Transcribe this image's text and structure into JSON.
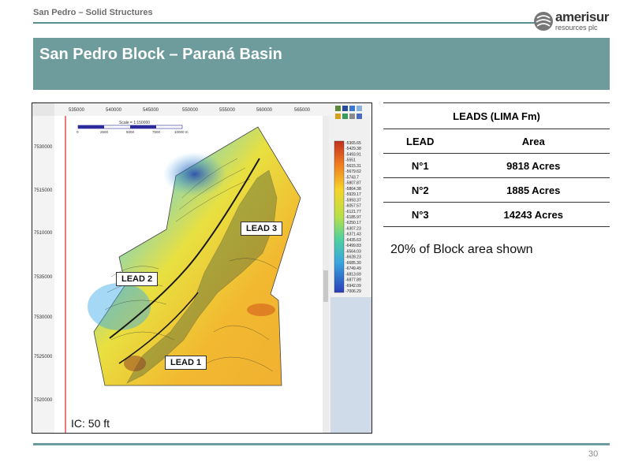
{
  "header": {
    "section": "San Pedro – Solid Structures"
  },
  "logo": {
    "name": "amerisur",
    "sub": "resources plc"
  },
  "banner": {
    "title": "San Pedro Block – Paraná Basin"
  },
  "map": {
    "x_ticks": [
      "535000",
      "540000",
      "545000",
      "550000",
      "555000",
      "560000",
      "565000"
    ],
    "y_ticks": [
      "7530000",
      "7515000",
      "7510000",
      "7535000",
      "7530000",
      "7525000",
      "7520000"
    ],
    "scale_caption": "Scale = 1:150000",
    "scale_ticks": [
      "0",
      "2500",
      "5000",
      "7500",
      "10000 m"
    ],
    "color_scale_values": [
      "-5365.65",
      "-5429.38",
      "-5493.91",
      "-5551",
      "-5615.31",
      "-5679.62",
      "-5743.7",
      "-5807.87",
      "-5864.38",
      "-5929.17",
      "-5993.37",
      "-6057.57",
      "-6121.77",
      "-6185.97",
      "-6250.17",
      "-6307.23",
      "-6371.43",
      "-6435.63",
      "-6499.83",
      "-6564.03",
      "-6628.23",
      "-6685.30",
      "-6749.49",
      "-6813.69",
      "-6877.89",
      "-6942.09",
      "-7006.29"
    ],
    "leads": [
      "LEAD 1",
      "LEAD 2",
      "LEAD 3"
    ],
    "ic_label": "IC: 50 ft"
  },
  "table": {
    "caption": "LEADS (LIMA Fm)",
    "headers": [
      "LEAD",
      "Area"
    ],
    "rows": [
      [
        "N°1",
        "9818 Acres"
      ],
      [
        "N°2",
        "1885 Acres"
      ],
      [
        "N°3",
        "14243 Acres"
      ]
    ]
  },
  "note": "20% of Block area shown",
  "footer": {
    "page": "30"
  }
}
